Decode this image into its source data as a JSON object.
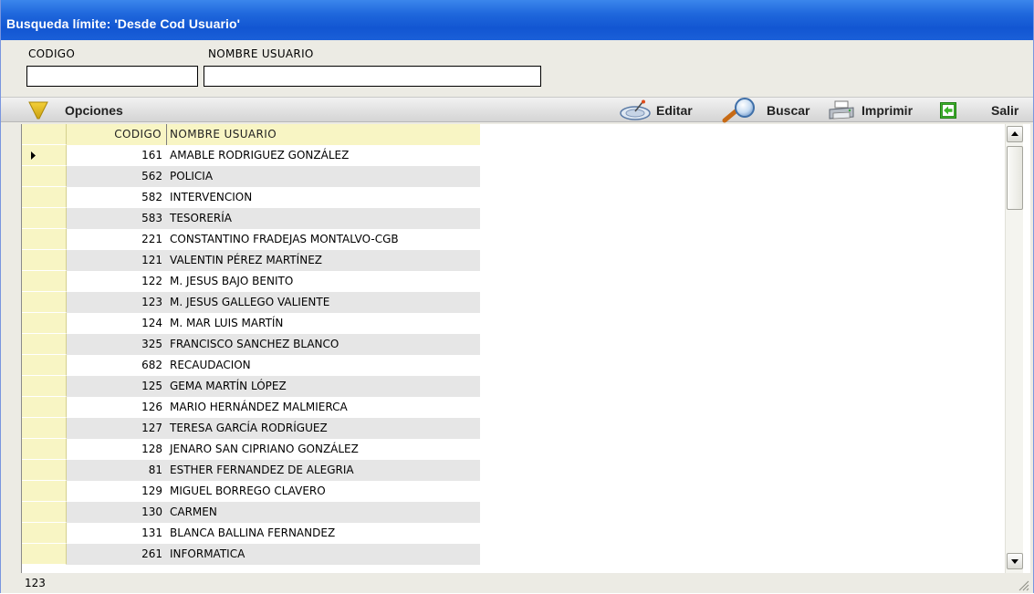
{
  "window": {
    "title": "Busqueda límite: 'Desde Cod Usuario'"
  },
  "filters": {
    "codigo_label": "CODIGO",
    "codigo_value": "",
    "nombre_label": "NOMBRE USUARIO",
    "nombre_value": ""
  },
  "toolbar": {
    "opciones": "Opciones",
    "editar": "Editar",
    "buscar": "Buscar",
    "imprimir": "Imprimir",
    "salir": "Salir"
  },
  "grid": {
    "columns": [
      "CODIGO",
      "NOMBRE USUARIO"
    ],
    "selected_row": 0,
    "rows": [
      {
        "codigo": "161",
        "nombre": "AMABLE RODRIGUEZ GONZÁLEZ"
      },
      {
        "codigo": "562",
        "nombre": "POLICIA"
      },
      {
        "codigo": "582",
        "nombre": "INTERVENCION"
      },
      {
        "codigo": "583",
        "nombre": "TESORERÍA"
      },
      {
        "codigo": "221",
        "nombre": "CONSTANTINO  FRADEJAS  MONTALVO-CGB"
      },
      {
        "codigo": "121",
        "nombre": "VALENTIN PÉREZ MARTÍNEZ"
      },
      {
        "codigo": "122",
        "nombre": "M. JESUS BAJO BENITO"
      },
      {
        "codigo": "123",
        "nombre": "M. JESUS GALLEGO VALIENTE"
      },
      {
        "codigo": "124",
        "nombre": "M. MAR LUIS MARTÍN"
      },
      {
        "codigo": "325",
        "nombre": "FRANCISCO SANCHEZ BLANCO"
      },
      {
        "codigo": "682",
        "nombre": "RECAUDACION"
      },
      {
        "codigo": "125",
        "nombre": "GEMA MARTÍN LÓPEZ"
      },
      {
        "codigo": "126",
        "nombre": "MARIO HERNÁNDEZ MALMIERCA"
      },
      {
        "codigo": "127",
        "nombre": "TERESA GARCÍA RODRÍGUEZ"
      },
      {
        "codigo": "128",
        "nombre": "JENARO SAN CIPRIANO GONZÁLEZ"
      },
      {
        "codigo": "81",
        "nombre": "ESTHER FERNANDEZ DE ALEGRIA"
      },
      {
        "codigo": "129",
        "nombre": "MIGUEL BORREGO CLAVERO"
      },
      {
        "codigo": "130",
        "nombre": "CARMEN"
      },
      {
        "codigo": "131",
        "nombre": "BLANCA BALLINA FERNANDEZ"
      },
      {
        "codigo": "261",
        "nombre": "INFORMATICA"
      }
    ]
  },
  "status": {
    "text": "123"
  },
  "colors": {
    "row_alt": "#e6e6e6",
    "row_base": "#ffffff",
    "indicator": "#f8f5c4"
  }
}
